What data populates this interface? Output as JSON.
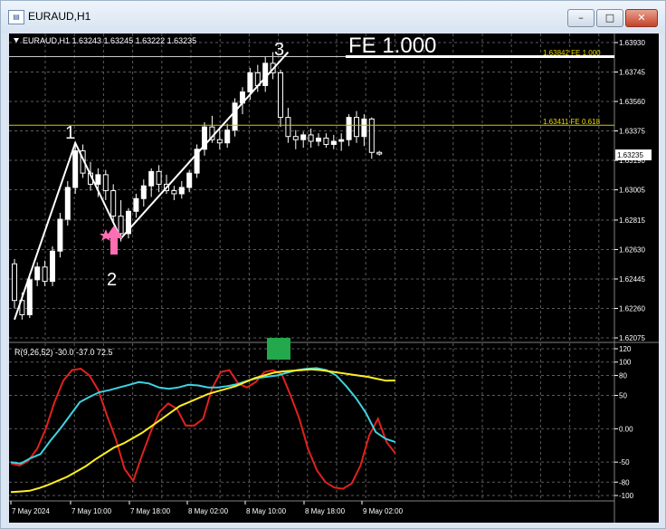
{
  "window": {
    "title": "EURAUD,H1"
  },
  "controls": {
    "minimize": "–",
    "maximize": "□",
    "close": "✕"
  },
  "price_panel": {
    "header": "EURAUD,H1  1.63243 1.63245 1.63222 1.63235",
    "price_ticks": [
      "1.63930",
      "1.63745",
      "1.63560",
      "1.63375",
      "1.63190",
      "1.63005",
      "1.62815",
      "1.62630",
      "1.62445",
      "1.62260",
      "1.62075"
    ],
    "current_price": "1.63235",
    "fe_title": "FE  1.000",
    "fe_1000_label": "1.63842  FE 1.000",
    "fe_0618_label": "1.63411  FE 0.618",
    "wave_labels": [
      "1",
      "2",
      "3"
    ]
  },
  "indicator_panel": {
    "header": "R(9,26,52) -30.0 -37.0 72.5",
    "ticks": [
      "120",
      "100",
      "80",
      "50",
      "0.00",
      "-50",
      "-80",
      "-100"
    ]
  },
  "time_axis": [
    "7 May 2024",
    "7 May 10:00",
    "7 May 18:00",
    "8 May 02:00",
    "8 May 10:00",
    "8 May 18:00",
    "9 May 02:00"
  ],
  "colors": {
    "background": "#000000",
    "bull_candle": "#ffffff",
    "bear_candle": "#000000",
    "grid": "#5a5a5a",
    "fe_line": "#ffffff",
    "fe_0618_line": "#d8c400",
    "fe_level_text": "#e8d800",
    "wave_line": "#ffffff",
    "arrow": "#ff6eb4",
    "signal_box": "#23a84b",
    "rsi_fast": "#e0221c",
    "rsi_mid": "#3fd3e3",
    "rsi_slow": "#ffee22"
  },
  "icons": {
    "app": "chart-window-icon",
    "dropdown": "triangle-down-icon",
    "arrow": "arrow-up-icon",
    "star": "star-icon"
  },
  "chart_data": [
    {
      "type": "candlestick",
      "symbol": "EURAUD",
      "timeframe": "H1",
      "ylim": [
        1.62075,
        1.6393
      ],
      "ohlc": [
        [
          1.6254,
          1.6257,
          1.6226,
          1.6231
        ],
        [
          1.6231,
          1.6236,
          1.6219,
          1.6222
        ],
        [
          1.6222,
          1.6248,
          1.622,
          1.6244
        ],
        [
          1.6244,
          1.6255,
          1.624,
          1.6252
        ],
        [
          1.6252,
          1.6256,
          1.624,
          1.6243
        ],
        [
          1.6243,
          1.6265,
          1.624,
          1.6262
        ],
        [
          1.6262,
          1.6286,
          1.6258,
          1.6282
        ],
        [
          1.6282,
          1.6306,
          1.6278,
          1.6302
        ],
        [
          1.6302,
          1.633,
          1.6298,
          1.6325
        ],
        [
          1.6325,
          1.6329,
          1.6308,
          1.6311
        ],
        [
          1.6311,
          1.6318,
          1.63,
          1.6304
        ],
        [
          1.6304,
          1.6314,
          1.6296,
          1.631
        ],
        [
          1.631,
          1.6313,
          1.6294,
          1.63
        ],
        [
          1.63,
          1.6304,
          1.628,
          1.6284
        ],
        [
          1.6284,
          1.6294,
          1.6268,
          1.6273
        ],
        [
          1.6273,
          1.6289,
          1.627,
          1.6287
        ],
        [
          1.6287,
          1.6298,
          1.6283,
          1.6295
        ],
        [
          1.6295,
          1.6307,
          1.629,
          1.6303
        ],
        [
          1.6303,
          1.6314,
          1.6296,
          1.6312
        ],
        [
          1.6312,
          1.6316,
          1.6299,
          1.6304
        ],
        [
          1.6304,
          1.631,
          1.6298,
          1.63
        ],
        [
          1.63,
          1.6303,
          1.6294,
          1.6298
        ],
        [
          1.6298,
          1.6306,
          1.6295,
          1.6302
        ],
        [
          1.6302,
          1.6313,
          1.6299,
          1.6311
        ],
        [
          1.6311,
          1.6329,
          1.6308,
          1.6326
        ],
        [
          1.6326,
          1.6343,
          1.6322,
          1.634
        ],
        [
          1.634,
          1.6347,
          1.633,
          1.6332
        ],
        [
          1.6332,
          1.634,
          1.6326,
          1.633
        ],
        [
          1.633,
          1.6342,
          1.6327,
          1.6338
        ],
        [
          1.6338,
          1.6358,
          1.6334,
          1.6355
        ],
        [
          1.6355,
          1.6365,
          1.6348,
          1.6362
        ],
        [
          1.6362,
          1.6377,
          1.6357,
          1.6374
        ],
        [
          1.6374,
          1.6379,
          1.6362,
          1.6366
        ],
        [
          1.6366,
          1.6384,
          1.6362,
          1.638
        ],
        [
          1.638,
          1.6387,
          1.637,
          1.6374
        ],
        [
          1.6374,
          1.6376,
          1.634,
          1.6346
        ],
        [
          1.6346,
          1.6352,
          1.633,
          1.6334
        ],
        [
          1.6334,
          1.6338,
          1.6326,
          1.6332
        ],
        [
          1.6332,
          1.6337,
          1.6327,
          1.6335
        ],
        [
          1.6335,
          1.6339,
          1.6327,
          1.6331
        ],
        [
          1.6331,
          1.6336,
          1.6328,
          1.6333
        ],
        [
          1.6333,
          1.6336,
          1.6327,
          1.6329
        ],
        [
          1.6329,
          1.6335,
          1.6326,
          1.6331
        ],
        [
          1.6331,
          1.6336,
          1.6325,
          1.6332
        ],
        [
          1.6332,
          1.6348,
          1.6328,
          1.6346
        ],
        [
          1.6346,
          1.635,
          1.633,
          1.6334
        ],
        [
          1.6334,
          1.6348,
          1.6328,
          1.6345
        ],
        [
          1.6345,
          1.6346,
          1.632,
          1.6324
        ],
        [
          1.6324,
          1.6325,
          1.6322,
          1.6323
        ]
      ],
      "fe_levels": [
        {
          "label": "FE 1.000",
          "value": 1.63842
        },
        {
          "label": "FE 0.618",
          "value": 1.63411
        }
      ],
      "wave_points": [
        {
          "label": "1",
          "bar": 8,
          "price": 1.633
        },
        {
          "label": "2",
          "bar": 14,
          "price": 1.627
        },
        {
          "label": "3",
          "bar": 36,
          "price": 1.6387
        }
      ],
      "wave_start": {
        "bar": 0,
        "price": 1.6219
      }
    },
    {
      "type": "line",
      "name": "R(9,26,52)",
      "ylim": [
        -100,
        120
      ],
      "series": [
        {
          "values": [
            -52,
            -55,
            -48,
            -30,
            0,
            40,
            72,
            88,
            90,
            80,
            58,
            20,
            -15,
            -60,
            -78,
            -40,
            -5,
            25,
            38,
            30,
            5,
            5,
            15,
            60,
            85,
            88,
            68,
            62,
            70,
            85,
            88,
            82,
            50,
            15,
            -30,
            -62,
            -80,
            -88,
            -90,
            -82,
            -55,
            -10,
            15,
            -20,
            -37
          ]
        },
        {
          "values": [
            -50,
            -52,
            -44,
            -38,
            -18,
            0,
            20,
            40,
            48,
            55,
            58,
            62,
            66,
            70,
            68,
            62,
            60,
            62,
            66,
            65,
            62,
            62,
            64,
            67,
            72,
            76,
            78,
            80,
            84,
            88,
            90,
            91,
            88,
            80,
            64,
            46,
            24,
            -5,
            -15,
            -20
          ]
        },
        {
          "values": [
            -95,
            -94,
            -93,
            -89,
            -84,
            -78,
            -72,
            -64,
            -56,
            -46,
            -37,
            -28,
            -22,
            -14,
            -6,
            4,
            14,
            24,
            34,
            40,
            46,
            52,
            56,
            60,
            64,
            70,
            76,
            80,
            84,
            86,
            87,
            88,
            89,
            88,
            86,
            84,
            82,
            80,
            78,
            75,
            72,
            72.5
          ]
        }
      ]
    }
  ]
}
